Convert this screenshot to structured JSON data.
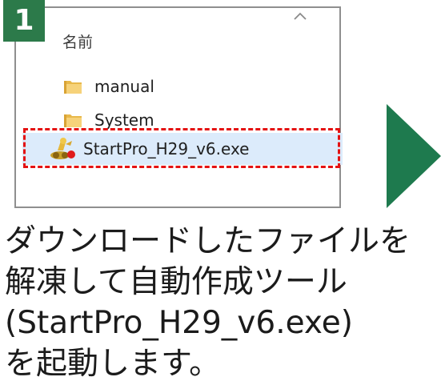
{
  "step": {
    "number": "1"
  },
  "explorer": {
    "column_header": "名前",
    "sort_icon": "chevron-up-icon",
    "files": [
      {
        "name": "manual",
        "icon": "folder-icon",
        "selected": false
      },
      {
        "name": "System",
        "icon": "folder-icon",
        "selected": false
      },
      {
        "name": "StartPro_H29_v6.exe",
        "icon": "application-exe-icon",
        "selected": true
      }
    ]
  },
  "highlight": {
    "style": "dashed",
    "color": "#e41212"
  },
  "arrow": {
    "icon": "next-step-arrow-icon",
    "color": "#1e7a4e"
  },
  "caption": {
    "line1": "ダウンロードしたファイルを",
    "line2": "解凍して自動作成ツール",
    "line3": "(StartPro_H29_v6.exe)",
    "line4": "を起動します。"
  },
  "colors": {
    "badge": "#2c7a4a",
    "selection": "#dcebfb",
    "folder": "#e8b84a"
  }
}
